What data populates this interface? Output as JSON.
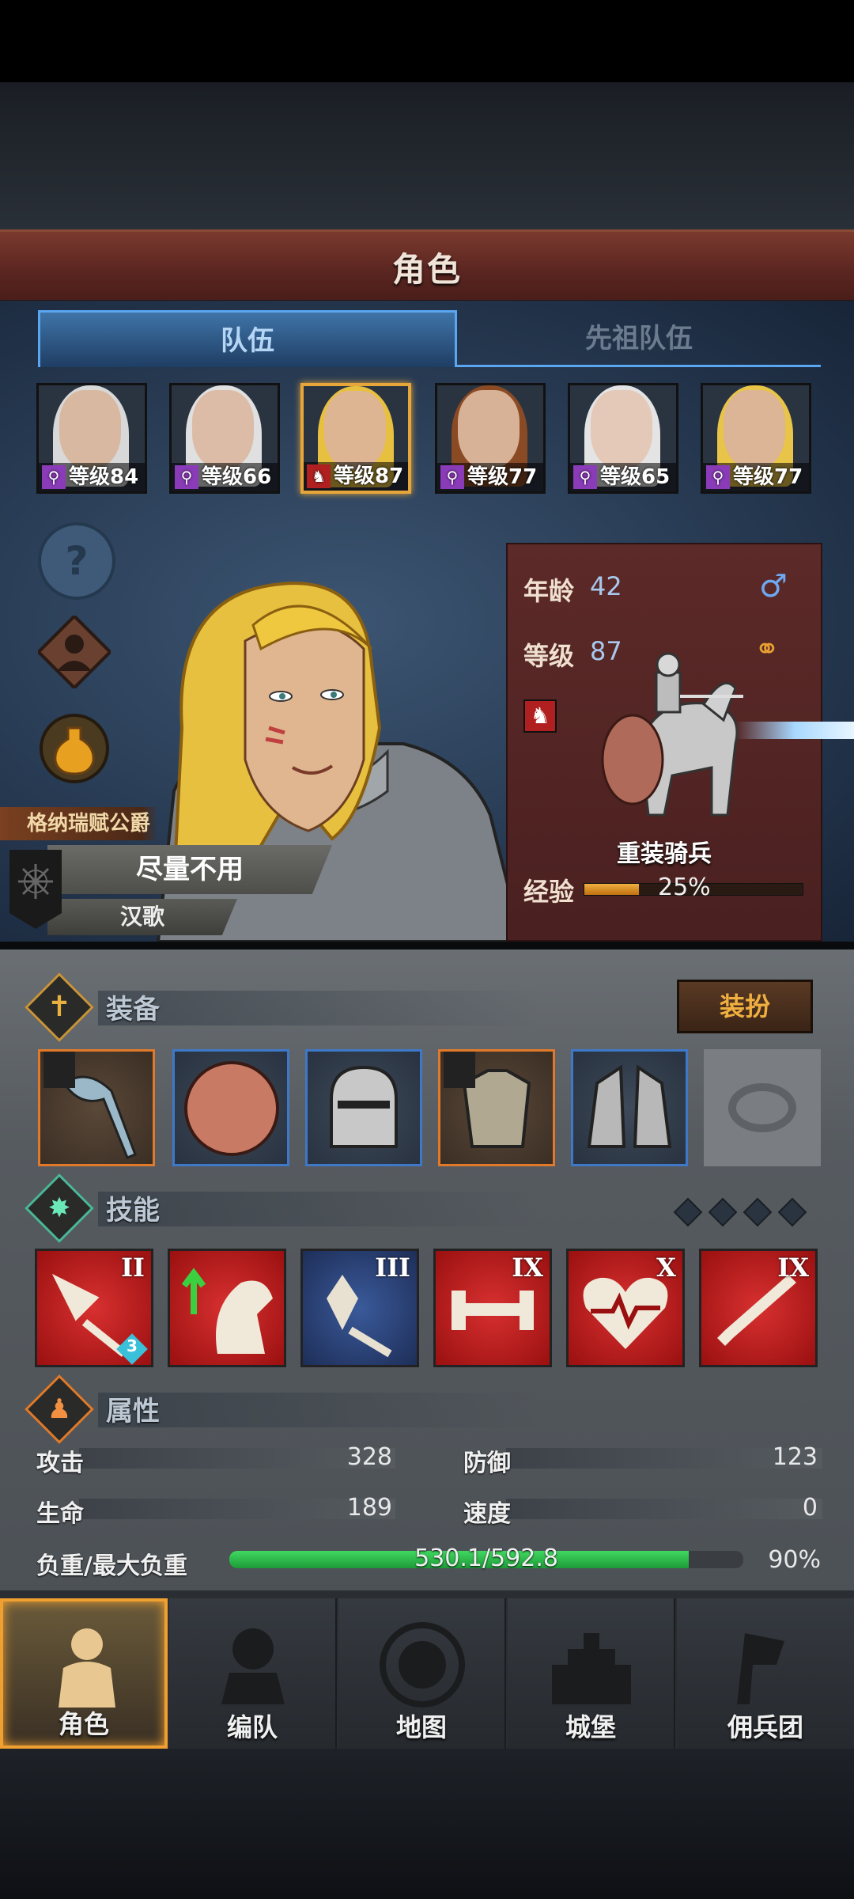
{
  "header": {
    "title": "角色"
  },
  "tabs": [
    {
      "label": "队伍"
    },
    {
      "label": "先祖队伍"
    }
  ],
  "party": [
    {
      "level_text": "等级84",
      "class_icon": "staff-icon"
    },
    {
      "level_text": "等级66",
      "class_icon": "staff-icon"
    },
    {
      "level_text": "等级87",
      "class_icon": "horse-icon"
    },
    {
      "level_text": "等级77",
      "class_icon": "staff-icon"
    },
    {
      "level_text": "等级65",
      "class_icon": "staff-icon"
    },
    {
      "level_text": "等级77",
      "class_icon": "staff-icon"
    }
  ],
  "hero": {
    "title_tag": "格纳瑞赋公爵",
    "command": "尽量不用",
    "name": "汉歌"
  },
  "card": {
    "age_label": "年龄",
    "age_value": "42",
    "level_label": "等级",
    "level_value": "87",
    "unit_name": "重装骑兵",
    "exp_label": "经验",
    "exp_value": "25%",
    "exp_fraction": 0.25
  },
  "equipment": {
    "title": "装备",
    "dress_button": "装扮",
    "slots": [
      "axe-icon",
      "shield-icon",
      "helmet-icon",
      "armor-icon",
      "boots-icon",
      "ring-icon"
    ]
  },
  "skills": {
    "title": "技能",
    "items": [
      {
        "rank": "II",
        "badge": "3",
        "icon": "broken-sword-icon"
      },
      {
        "rank": "",
        "icon": "horse-buff-icon"
      },
      {
        "rank": "III",
        "icon": "crystal-sword-icon"
      },
      {
        "rank": "IX",
        "icon": "dumbbell-icon"
      },
      {
        "rank": "X",
        "icon": "heart-pulse-icon"
      },
      {
        "rank": "IX",
        "icon": "sword-icon"
      }
    ]
  },
  "attributes": {
    "title": "属性",
    "attack_label": "攻击",
    "attack_value": "328",
    "defense_label": "防御",
    "defense_value": "123",
    "life_label": "生命",
    "life_value": "189",
    "speed_label": "速度",
    "speed_value": "0",
    "load_label": "负重/最大负重",
    "load_value": "530.1/592.8",
    "load_percent": "90%",
    "load_fraction": 0.894
  },
  "nav": [
    {
      "label": "角色"
    },
    {
      "label": "编队"
    },
    {
      "label": "地图"
    },
    {
      "label": "城堡"
    },
    {
      "label": "佣兵团"
    }
  ],
  "colors": {
    "accent": "#e6a63a",
    "tab_blue": "#5aa6f0",
    "title_red": "#5a2520",
    "load_green": "#2eb84a"
  }
}
